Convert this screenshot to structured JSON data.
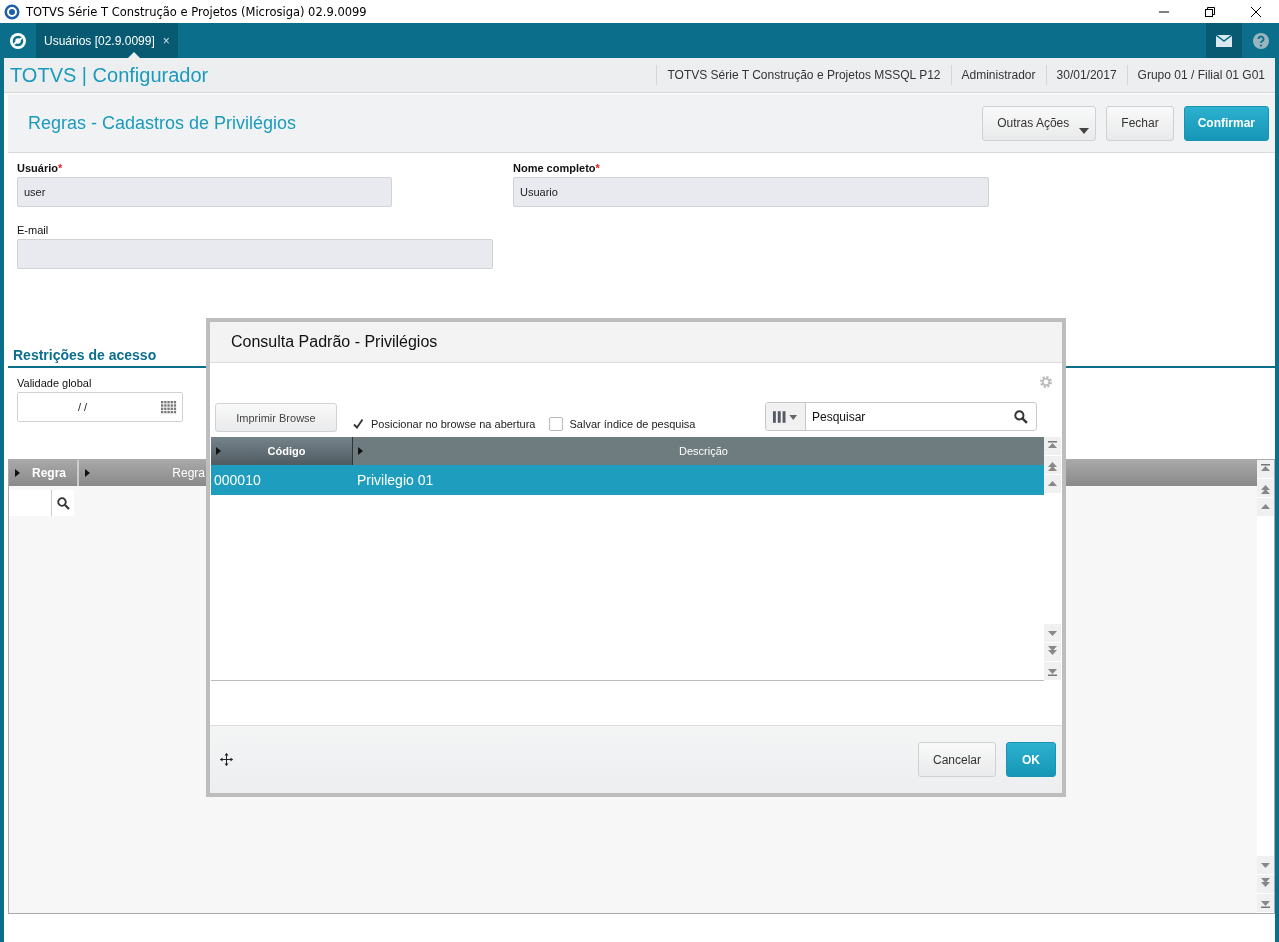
{
  "window": {
    "title": "TOTVS Série T Construção e Projetos (Microsiga) 02.9.0099"
  },
  "tabs": [
    {
      "label": "Usuários [02.9.0099]",
      "selected": true,
      "close": "×"
    }
  ],
  "app_header": {
    "title": "TOTVS | Configurador",
    "info": [
      "TOTVS Série T Construção e Projetos MSSQL P12",
      "Administrador",
      "30/01/2017",
      "Grupo 01 / Filial 01 G01"
    ]
  },
  "page": {
    "title": "Regras - Cadastros de Privilégios",
    "actions": [
      {
        "label": "Outras Ações",
        "kind": "menu"
      },
      {
        "label": "Fechar",
        "kind": "default"
      },
      {
        "label": "Confirmar",
        "kind": "primary"
      }
    ]
  },
  "fields": [
    {
      "label": "Usuário",
      "required_mark": "*",
      "value": "user"
    },
    {
      "label": "Nome completo",
      "required_mark": "*",
      "value": "Usuario"
    },
    {
      "label": "E-mail"
    }
  ],
  "restrictions": {
    "title": "Restrições de acesso",
    "date_field": {
      "label": "Validade global",
      "value": "/ /"
    },
    "grid": {
      "columns": [
        "Regra",
        "Regra"
      ]
    }
  },
  "dialog": {
    "title": "Consulta Padrão - Privilégios",
    "print_button": "Imprimir Browse",
    "options": [
      {
        "label": "Posicionar no browse na abertura",
        "checked": true
      },
      {
        "label": "Salvar índice de pesquisa",
        "checked": false
      }
    ],
    "search": {
      "placeholder": "Pesquisar"
    },
    "table": {
      "columns": [
        "Código",
        "Descrição"
      ],
      "rows": [
        {
          "cells": [
            "000010",
            "Privilegio 01"
          ],
          "selected": true
        }
      ]
    },
    "buttons": [
      {
        "label": "Cancelar",
        "kind": "default"
      },
      {
        "label": "OK",
        "kind": "primary"
      }
    ]
  }
}
